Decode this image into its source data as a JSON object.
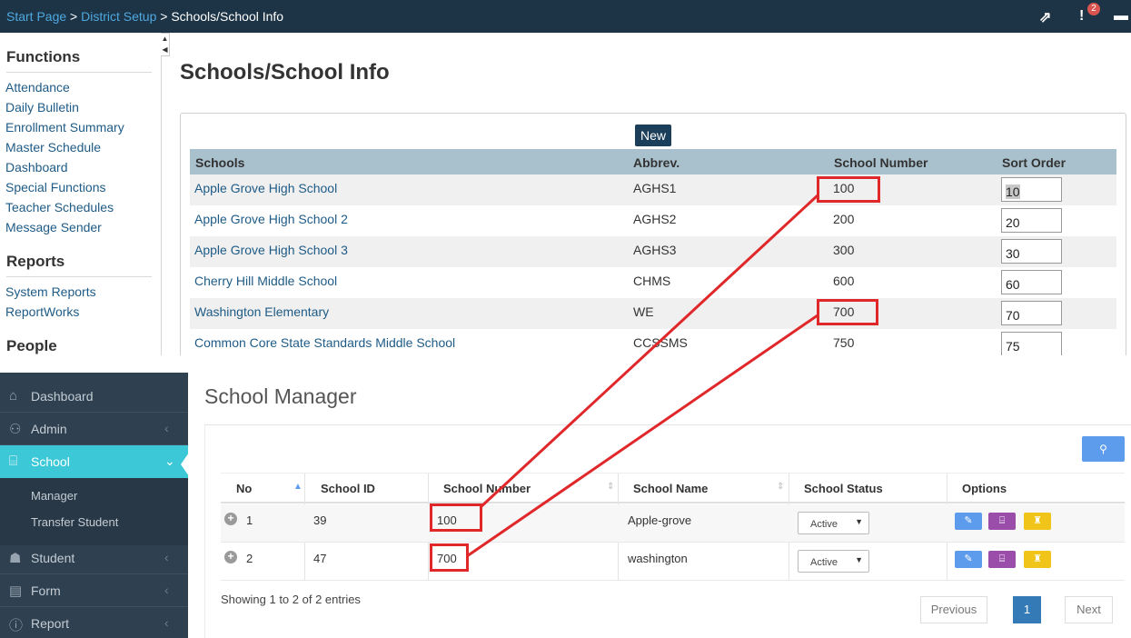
{
  "top": {
    "breadcrumb": [
      "Start Page",
      "District Setup",
      "Schools/School Info"
    ],
    "separator": ">",
    "notification_count": "2",
    "page_heading": "Schools/School Info"
  },
  "left_panel": {
    "sections": [
      {
        "title": "Functions",
        "items": [
          "Attendance",
          "Daily Bulletin",
          "Enrollment Summary",
          "Master Schedule",
          "Dashboard",
          "Special Functions",
          "Teacher Schedules",
          "Message Sender"
        ]
      },
      {
        "title": "Reports",
        "items": [
          "System Reports",
          "ReportWorks"
        ]
      },
      {
        "title": "People",
        "items": []
      }
    ]
  },
  "schools_table": {
    "new_label": "New",
    "columns": [
      "Schools",
      "Abbrev.",
      "School Number",
      "Sort Order"
    ],
    "rows": [
      {
        "name": "Apple Grove High School",
        "abbrev": "AGHS1",
        "number": "100",
        "sort": "10"
      },
      {
        "name": "Apple Grove High School 2",
        "abbrev": "AGHS2",
        "number": "200",
        "sort": "20"
      },
      {
        "name": "Apple Grove High School 3",
        "abbrev": "AGHS3",
        "number": "300",
        "sort": "30"
      },
      {
        "name": "Cherry Hill Middle School",
        "abbrev": "CHMS",
        "number": "600",
        "sort": "60"
      },
      {
        "name": "Washington Elementary",
        "abbrev": "WE",
        "number": "700",
        "sort": "70"
      },
      {
        "name": "Common Core State Standards Middle School",
        "abbrev": "CCSSMS",
        "number": "750",
        "sort": "75"
      }
    ]
  },
  "dark_sidebar": {
    "items": [
      {
        "label": "Dashboard",
        "icon": "home-icon"
      },
      {
        "label": "Admin",
        "icon": "user-icon"
      },
      {
        "label": "School",
        "icon": "bank-icon"
      },
      {
        "label": "Student",
        "icon": "graduation-cap-icon"
      },
      {
        "label": "Form",
        "icon": "file-icon"
      },
      {
        "label": "Report",
        "icon": "info-icon"
      }
    ],
    "school_submenu": [
      "Manager",
      "Transfer Student"
    ]
  },
  "manager": {
    "title": "School Manager",
    "columns": [
      "No",
      "School ID",
      "School Number",
      "School Name",
      "School Status",
      "Options"
    ],
    "rows": [
      {
        "no": "1",
        "school_id": "39",
        "number": "100",
        "name": "Apple-grove",
        "status": "Active"
      },
      {
        "no": "2",
        "school_id": "47",
        "number": "700",
        "name": "washington",
        "status": "Active"
      }
    ],
    "entries_info": "Showing 1 to 2 of 2 entries",
    "pagination": {
      "previous": "Previous",
      "current": "1",
      "next": "Next"
    }
  },
  "colors": {
    "top_bar": "#1d3446",
    "accent_teal": "#3cc8d6",
    "highlight_red": "#e0282b",
    "sidebar_dark": "#2f4050"
  }
}
